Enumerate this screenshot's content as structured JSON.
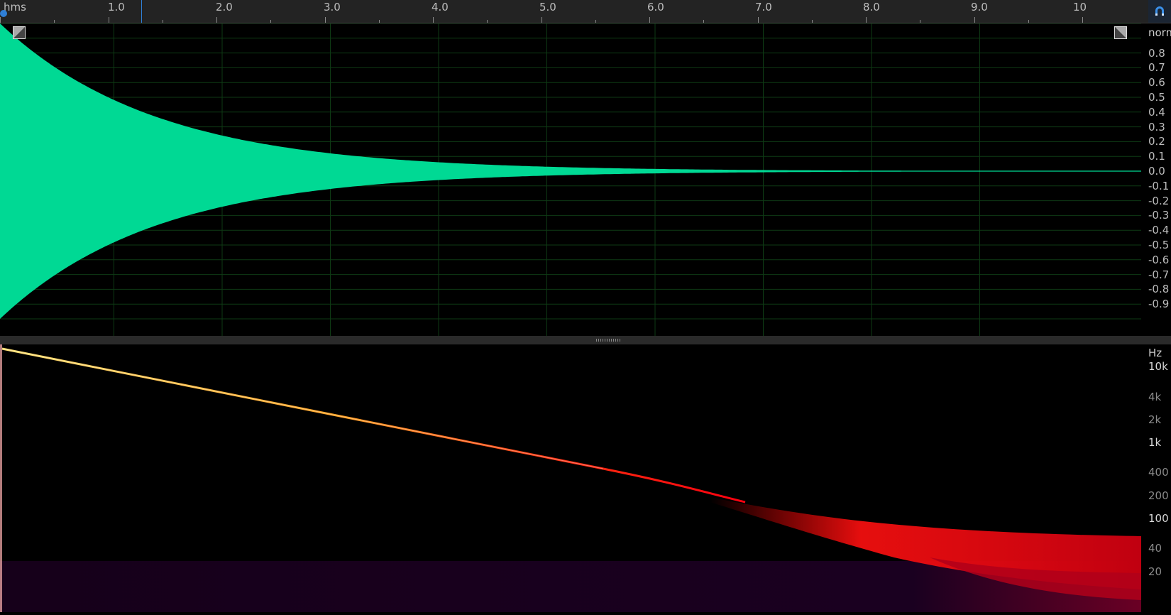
{
  "ruler": {
    "unit": "hms",
    "labels": [
      "1.0",
      "2.0",
      "3.0",
      "4.0",
      "5.0",
      "6.0",
      "7.0",
      "8.0",
      "9.0",
      "10"
    ]
  },
  "amplitude_scale": {
    "unit": "norm",
    "labels": [
      "0.8",
      "0.7",
      "0.6",
      "0.5",
      "0.4",
      "0.3",
      "0.2",
      "0.1",
      "0.0",
      "-0.1",
      "-0.2",
      "-0.3",
      "-0.4",
      "-0.5",
      "-0.6",
      "-0.7",
      "-0.8",
      "-0.9"
    ]
  },
  "frequency_scale": {
    "unit": "Hz",
    "labels": [
      "10k",
      "4k",
      "2k",
      "1k",
      "400",
      "200",
      "100",
      "40",
      "20"
    ]
  },
  "colors": {
    "waveform": "#00d994",
    "grid": "#0e3a14",
    "accent": "#2f7fd6"
  },
  "icons": {
    "snap": "magnet-icon",
    "fade_in": "fade-in-handle-icon",
    "fade_out": "fade-out-handle-icon"
  }
}
